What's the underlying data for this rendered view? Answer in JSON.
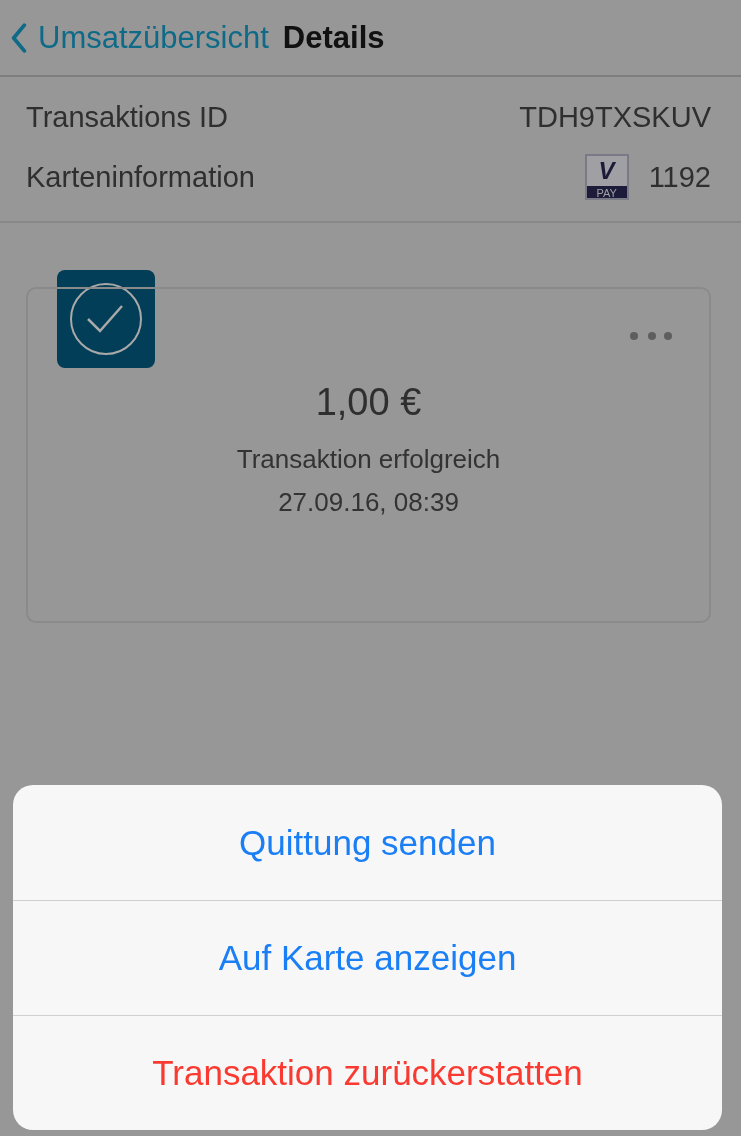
{
  "nav": {
    "back_label": "Umsatzübersicht",
    "title": "Details"
  },
  "info_rows": [
    {
      "label": "Transaktions ID",
      "value": "TDH9TXSKUV",
      "kind": "text"
    },
    {
      "label": "Karteninformation",
      "value": "1192",
      "kind": "card",
      "brand_mark": "V",
      "brand_label": "PAY"
    }
  ],
  "transaction": {
    "amount": "1,00 €",
    "status": "Transaktion erfolgreich",
    "datetime": "27.09.16, 08:39",
    "success": true
  },
  "action_sheet": [
    {
      "label": "Quittung senden",
      "kind": "default"
    },
    {
      "label": "Auf Karte anzeigen",
      "kind": "default"
    },
    {
      "label": "Transaktion zurückerstatten",
      "kind": "destructive"
    }
  ]
}
